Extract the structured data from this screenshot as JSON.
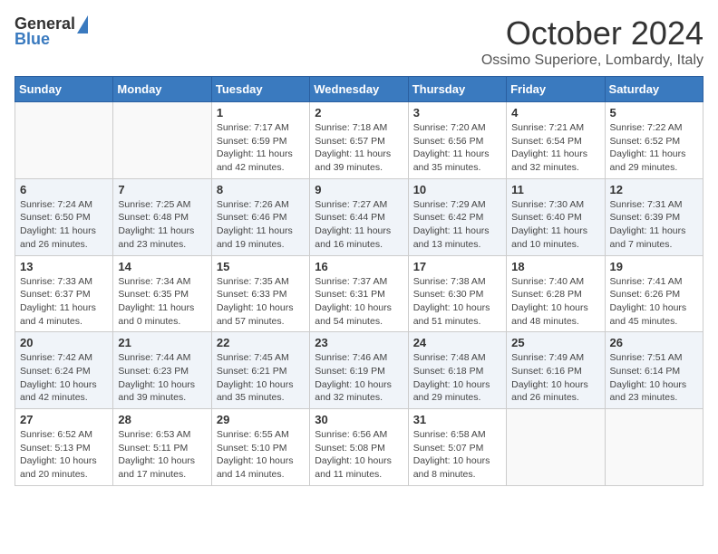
{
  "header": {
    "logo_general": "General",
    "logo_blue": "Blue",
    "month_title": "October 2024",
    "location": "Ossimo Superiore, Lombardy, Italy"
  },
  "days_of_week": [
    "Sunday",
    "Monday",
    "Tuesday",
    "Wednesday",
    "Thursday",
    "Friday",
    "Saturday"
  ],
  "weeks": [
    [
      {
        "day": "",
        "sunrise": "",
        "sunset": "",
        "daylight": ""
      },
      {
        "day": "",
        "sunrise": "",
        "sunset": "",
        "daylight": ""
      },
      {
        "day": "1",
        "sunrise": "Sunrise: 7:17 AM",
        "sunset": "Sunset: 6:59 PM",
        "daylight": "Daylight: 11 hours and 42 minutes."
      },
      {
        "day": "2",
        "sunrise": "Sunrise: 7:18 AM",
        "sunset": "Sunset: 6:57 PM",
        "daylight": "Daylight: 11 hours and 39 minutes."
      },
      {
        "day": "3",
        "sunrise": "Sunrise: 7:20 AM",
        "sunset": "Sunset: 6:56 PM",
        "daylight": "Daylight: 11 hours and 35 minutes."
      },
      {
        "day": "4",
        "sunrise": "Sunrise: 7:21 AM",
        "sunset": "Sunset: 6:54 PM",
        "daylight": "Daylight: 11 hours and 32 minutes."
      },
      {
        "day": "5",
        "sunrise": "Sunrise: 7:22 AM",
        "sunset": "Sunset: 6:52 PM",
        "daylight": "Daylight: 11 hours and 29 minutes."
      }
    ],
    [
      {
        "day": "6",
        "sunrise": "Sunrise: 7:24 AM",
        "sunset": "Sunset: 6:50 PM",
        "daylight": "Daylight: 11 hours and 26 minutes."
      },
      {
        "day": "7",
        "sunrise": "Sunrise: 7:25 AM",
        "sunset": "Sunset: 6:48 PM",
        "daylight": "Daylight: 11 hours and 23 minutes."
      },
      {
        "day": "8",
        "sunrise": "Sunrise: 7:26 AM",
        "sunset": "Sunset: 6:46 PM",
        "daylight": "Daylight: 11 hours and 19 minutes."
      },
      {
        "day": "9",
        "sunrise": "Sunrise: 7:27 AM",
        "sunset": "Sunset: 6:44 PM",
        "daylight": "Daylight: 11 hours and 16 minutes."
      },
      {
        "day": "10",
        "sunrise": "Sunrise: 7:29 AM",
        "sunset": "Sunset: 6:42 PM",
        "daylight": "Daylight: 11 hours and 13 minutes."
      },
      {
        "day": "11",
        "sunrise": "Sunrise: 7:30 AM",
        "sunset": "Sunset: 6:40 PM",
        "daylight": "Daylight: 11 hours and 10 minutes."
      },
      {
        "day": "12",
        "sunrise": "Sunrise: 7:31 AM",
        "sunset": "Sunset: 6:39 PM",
        "daylight": "Daylight: 11 hours and 7 minutes."
      }
    ],
    [
      {
        "day": "13",
        "sunrise": "Sunrise: 7:33 AM",
        "sunset": "Sunset: 6:37 PM",
        "daylight": "Daylight: 11 hours and 4 minutes."
      },
      {
        "day": "14",
        "sunrise": "Sunrise: 7:34 AM",
        "sunset": "Sunset: 6:35 PM",
        "daylight": "Daylight: 11 hours and 0 minutes."
      },
      {
        "day": "15",
        "sunrise": "Sunrise: 7:35 AM",
        "sunset": "Sunset: 6:33 PM",
        "daylight": "Daylight: 10 hours and 57 minutes."
      },
      {
        "day": "16",
        "sunrise": "Sunrise: 7:37 AM",
        "sunset": "Sunset: 6:31 PM",
        "daylight": "Daylight: 10 hours and 54 minutes."
      },
      {
        "day": "17",
        "sunrise": "Sunrise: 7:38 AM",
        "sunset": "Sunset: 6:30 PM",
        "daylight": "Daylight: 10 hours and 51 minutes."
      },
      {
        "day": "18",
        "sunrise": "Sunrise: 7:40 AM",
        "sunset": "Sunset: 6:28 PM",
        "daylight": "Daylight: 10 hours and 48 minutes."
      },
      {
        "day": "19",
        "sunrise": "Sunrise: 7:41 AM",
        "sunset": "Sunset: 6:26 PM",
        "daylight": "Daylight: 10 hours and 45 minutes."
      }
    ],
    [
      {
        "day": "20",
        "sunrise": "Sunrise: 7:42 AM",
        "sunset": "Sunset: 6:24 PM",
        "daylight": "Daylight: 10 hours and 42 minutes."
      },
      {
        "day": "21",
        "sunrise": "Sunrise: 7:44 AM",
        "sunset": "Sunset: 6:23 PM",
        "daylight": "Daylight: 10 hours and 39 minutes."
      },
      {
        "day": "22",
        "sunrise": "Sunrise: 7:45 AM",
        "sunset": "Sunset: 6:21 PM",
        "daylight": "Daylight: 10 hours and 35 minutes."
      },
      {
        "day": "23",
        "sunrise": "Sunrise: 7:46 AM",
        "sunset": "Sunset: 6:19 PM",
        "daylight": "Daylight: 10 hours and 32 minutes."
      },
      {
        "day": "24",
        "sunrise": "Sunrise: 7:48 AM",
        "sunset": "Sunset: 6:18 PM",
        "daylight": "Daylight: 10 hours and 29 minutes."
      },
      {
        "day": "25",
        "sunrise": "Sunrise: 7:49 AM",
        "sunset": "Sunset: 6:16 PM",
        "daylight": "Daylight: 10 hours and 26 minutes."
      },
      {
        "day": "26",
        "sunrise": "Sunrise: 7:51 AM",
        "sunset": "Sunset: 6:14 PM",
        "daylight": "Daylight: 10 hours and 23 minutes."
      }
    ],
    [
      {
        "day": "27",
        "sunrise": "Sunrise: 6:52 AM",
        "sunset": "Sunset: 5:13 PM",
        "daylight": "Daylight: 10 hours and 20 minutes."
      },
      {
        "day": "28",
        "sunrise": "Sunrise: 6:53 AM",
        "sunset": "Sunset: 5:11 PM",
        "daylight": "Daylight: 10 hours and 17 minutes."
      },
      {
        "day": "29",
        "sunrise": "Sunrise: 6:55 AM",
        "sunset": "Sunset: 5:10 PM",
        "daylight": "Daylight: 10 hours and 14 minutes."
      },
      {
        "day": "30",
        "sunrise": "Sunrise: 6:56 AM",
        "sunset": "Sunset: 5:08 PM",
        "daylight": "Daylight: 10 hours and 11 minutes."
      },
      {
        "day": "31",
        "sunrise": "Sunrise: 6:58 AM",
        "sunset": "Sunset: 5:07 PM",
        "daylight": "Daylight: 10 hours and 8 minutes."
      },
      {
        "day": "",
        "sunrise": "",
        "sunset": "",
        "daylight": ""
      },
      {
        "day": "",
        "sunrise": "",
        "sunset": "",
        "daylight": ""
      }
    ]
  ]
}
